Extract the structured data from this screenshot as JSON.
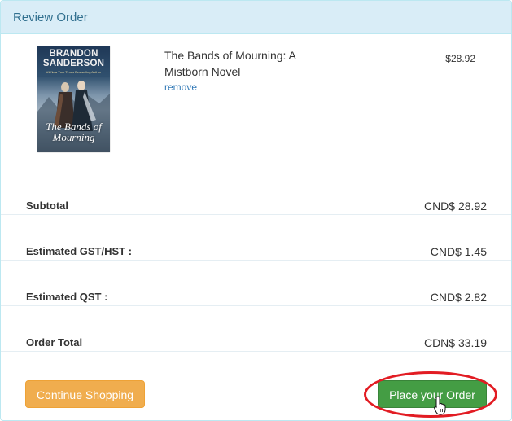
{
  "panel": {
    "title": "Review Order"
  },
  "cart_item": {
    "cover": {
      "author_line1": "BRANDON",
      "author_line2": "SANDERSON",
      "tagline": "#1 New York Times Bestselling Author",
      "title_line1": "The Bands of",
      "title_line2": "Mourning"
    },
    "title_line1": "The Bands of Mourning: A",
    "title_line2": "Mistborn Novel",
    "remove_label": "remove",
    "price": "$28.92"
  },
  "summary": {
    "subtotal_label": "Subtotal",
    "subtotal_value": "CND$ 28.92",
    "gst_label": "Estimated GST/HST :",
    "gst_value": "CND$ 1.45",
    "qst_label": "Estimated QST :",
    "qst_value": "CND$ 2.82",
    "total_label": "Order Total",
    "total_value": "CDN$ 33.19"
  },
  "actions": {
    "continue_label": "Continue Shopping",
    "place_order_label": "Place your Order"
  },
  "colors": {
    "heading_bg": "#d9edf7",
    "heading_text": "#31708f",
    "link": "#337ab7",
    "warning_button": "#f0ad4e",
    "success_button": "#449d44",
    "annotation_ellipse": "#e21c23"
  }
}
